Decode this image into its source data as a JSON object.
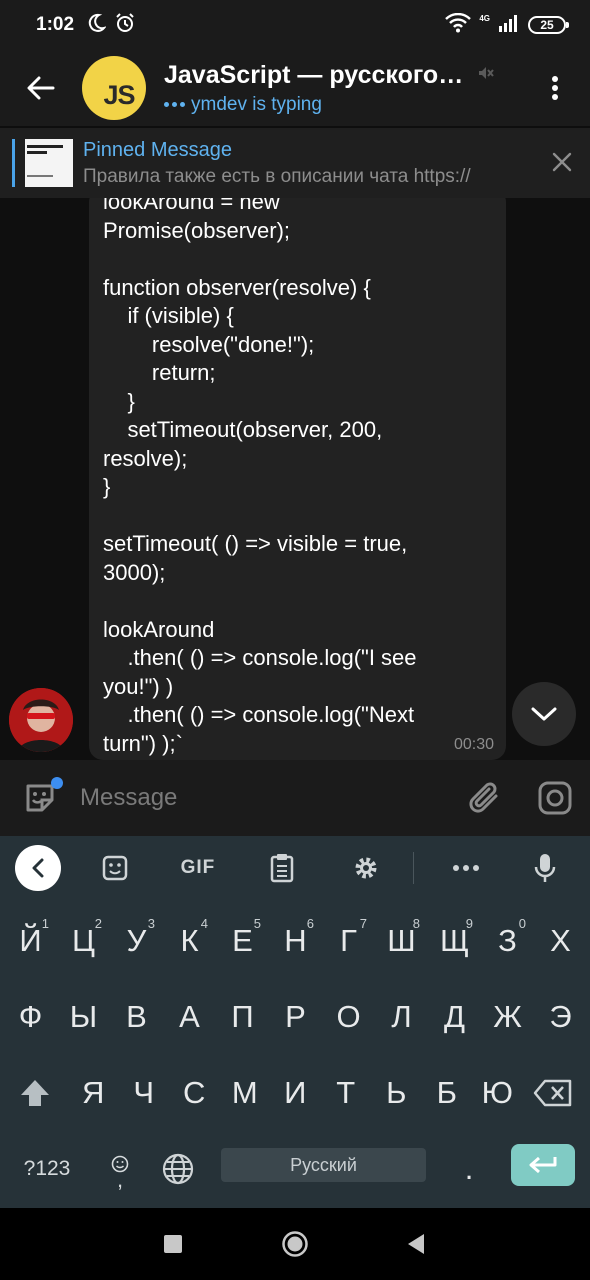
{
  "status_bar": {
    "time": "1:02",
    "network": "4G",
    "battery": "25"
  },
  "header": {
    "avatar_text": "JS",
    "title": "JavaScript — русскоговорящее сообщество",
    "typing_text": "ymdev is typing"
  },
  "pinned": {
    "title": "Pinned Message",
    "text": "Правила также есть в описании чата https://"
  },
  "message": {
    "lines": [
      "lookAround = new",
      "Promise(observer);",
      "",
      "function observer(resolve) {",
      "    if (visible) {",
      "        resolve(\"done!\");",
      "        return;",
      "    }",
      "    setTimeout(observer, 200,",
      "resolve);",
      "}",
      "",
      "setTimeout( () => visible = true,",
      "3000);",
      "",
      "lookAround",
      "    .then( () => console.log(\"I see",
      "you!\") )",
      "    .then( () => console.log(\"Next",
      "turn\") );`"
    ],
    "time": "00:30"
  },
  "composer": {
    "placeholder": "Message"
  },
  "keyboard": {
    "toolbar": {
      "gif": "GIF"
    },
    "row1": [
      {
        "k": "Й",
        "n": "1"
      },
      {
        "k": "Ц",
        "n": "2"
      },
      {
        "k": "У",
        "n": "3"
      },
      {
        "k": "К",
        "n": "4"
      },
      {
        "k": "Е",
        "n": "5"
      },
      {
        "k": "Н",
        "n": "6"
      },
      {
        "k": "Г",
        "n": "7"
      },
      {
        "k": "Ш",
        "n": "8"
      },
      {
        "k": "Щ",
        "n": "9"
      },
      {
        "k": "З",
        "n": "0"
      },
      {
        "k": "Х",
        "n": ""
      }
    ],
    "row2": [
      "Ф",
      "Ы",
      "В",
      "А",
      "П",
      "Р",
      "О",
      "Л",
      "Д",
      "Ж",
      "Э"
    ],
    "row3": [
      "Я",
      "Ч",
      "С",
      "М",
      "И",
      "Т",
      "Ь",
      "Б",
      "Ю"
    ],
    "symbols_key": "?123",
    "comma_key": ",",
    "space_label": "Русский",
    "period_key": "."
  },
  "colors": {
    "accent": "#5fb2ef",
    "js_avatar": "#f2d347",
    "keyboard_bg": "#263238",
    "enter_key": "#80cbc4"
  }
}
